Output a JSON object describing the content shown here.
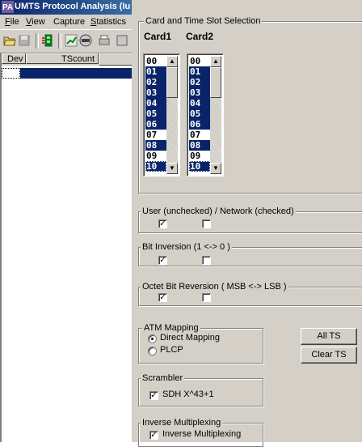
{
  "app": {
    "title": "UMTS Protocol Analysis (Iu",
    "menu": [
      {
        "prefix": "",
        "ul": "F",
        "rest": "ile"
      },
      {
        "prefix": "",
        "ul": "V",
        "rest": "iew"
      },
      {
        "prefix": "Capture",
        "ul": "",
        "rest": ""
      },
      {
        "prefix": "",
        "ul": "S",
        "rest": "tatistics"
      }
    ],
    "columns": [
      "Dev",
      "TScount"
    ]
  },
  "dialog": {
    "card_group": {
      "label": "Card and Time Slot Selection",
      "card1_label": "Card1",
      "card2_label": "Card2",
      "card1_items": [
        "00",
        "01",
        "02",
        "03",
        "04",
        "05",
        "06",
        "07",
        "08",
        "09",
        "10"
      ],
      "card1_selected": [
        false,
        true,
        true,
        true,
        true,
        true,
        true,
        false,
        true,
        false,
        true
      ],
      "card2_items": [
        "00",
        "01",
        "02",
        "03",
        "04",
        "05",
        "06",
        "07",
        "08",
        "09",
        "10"
      ],
      "card2_selected": [
        false,
        true,
        true,
        true,
        true,
        true,
        true,
        false,
        true,
        false,
        true
      ]
    },
    "user_network": {
      "label": "User (unchecked) / Network (checked)",
      "card1_checked": true,
      "card2_checked": false
    },
    "bit_inversion": {
      "label": "Bit Inversion (1 <-> 0 )",
      "card1_checked": true,
      "card2_checked": false
    },
    "octet_reversal": {
      "label": "Octet Bit Reversion ( MSB <-> LSB )",
      "card1_checked": true,
      "card2_checked": false
    },
    "atm_mapping": {
      "label": "ATM  Mapping",
      "options": [
        "Direct Mapping",
        "PLCP"
      ],
      "selected": "Direct Mapping"
    },
    "all_ts_label": "All TS",
    "clear_ts_label": "Clear TS",
    "scrambler": {
      "label": "Scrambler",
      "option_label": "SDH  X^43+1",
      "checked": true
    },
    "inverse_mux": {
      "label": "Inverse Multiplexing",
      "option_label": "Inverse Multiplexing",
      "checked": true
    }
  }
}
